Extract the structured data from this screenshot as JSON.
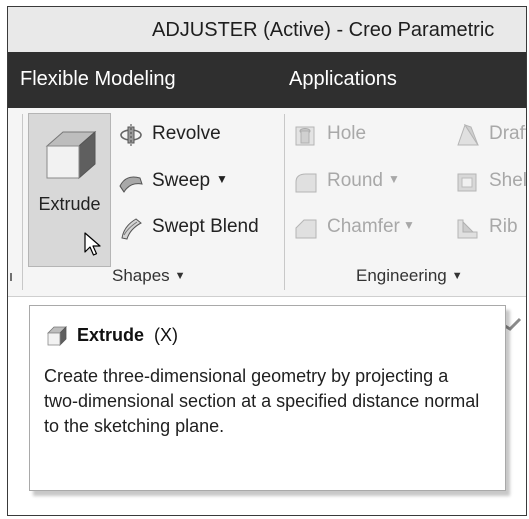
{
  "window": {
    "title": "ADJUSTER (Active) - Creo Parametric"
  },
  "menu": {
    "tabs": [
      "Flexible Modeling",
      "Applications"
    ]
  },
  "ribbon": {
    "shapes": {
      "extrude_label": "Extrude",
      "revolve_label": "Revolve",
      "sweep_label": "Sweep",
      "swept_blend_label": "Swept Blend",
      "group_label": "Shapes"
    },
    "engineering": {
      "hole_label": "Hole",
      "round_label": "Round",
      "chamfer_label": "Chamfer",
      "draft_label": "Draft",
      "shell_label": "Shell",
      "rib_label": "Rib",
      "group_label": "Engineering"
    },
    "dropdown_glyph": "▼"
  },
  "tooltip": {
    "title": "Extrude",
    "shortcut": "(X)",
    "description": "Create three-dimensional geometry by projecting a two-dimensional section at a specified distance normal to the sketching plane."
  },
  "icons": {
    "extrude": "extrude-icon",
    "revolve": "revolve-icon",
    "sweep": "sweep-icon",
    "swept_blend": "swept-blend-icon",
    "hole": "hole-icon",
    "round": "round-icon",
    "chamfer": "chamfer-icon",
    "draft": "draft-icon",
    "shell": "shell-icon",
    "rib": "rib-icon",
    "cursor": "mouse-pointer-icon"
  },
  "colors": {
    "menubar_bg": "#2f2f2f",
    "titlebar_bg": "#e9e9e9",
    "ribbon_bg": "#f5f5f5",
    "active_button_bg": "#d8d8d8",
    "disabled_text": "#a8a8a8"
  }
}
